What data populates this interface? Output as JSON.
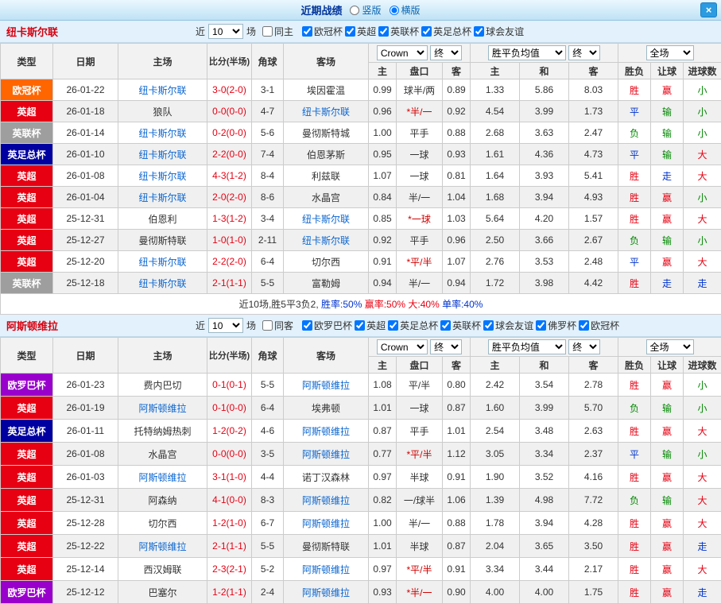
{
  "titlebar": {
    "title": "近期战绩",
    "layout_options": [
      {
        "label": "竖版",
        "selected": false
      },
      {
        "label": "横版",
        "selected": true
      }
    ],
    "close": "×"
  },
  "columns": {
    "type": "类型",
    "date": "日期",
    "home": "主场",
    "score": "比分(半场)",
    "corner": "角球",
    "away": "客场",
    "asian_home": "主",
    "handicap": "盘口",
    "asian_away": "客",
    "euro_home": "主",
    "euro_draw": "和",
    "euro_away": "客",
    "result": "胜负",
    "handicap_result": "让球",
    "goals": "进球数"
  },
  "type_colors": {
    "欧冠杯": "#ff6600",
    "英超": "#e60012",
    "英联杯": "#9e9e9e",
    "英足总杯": "#0000a0",
    "欧罗巴杯": "#9900cc"
  },
  "result_colors": {
    "胜": "#e60012",
    "平": "#0033cc",
    "负": "#008800",
    "赢": "#e60012",
    "输": "#008800",
    "走": "#0033cc",
    "大": "#e60012",
    "小": "#008800"
  },
  "sections": [
    {
      "team": "纽卡斯尔联",
      "near_label": "近",
      "near_count": "10",
      "games_label": "场",
      "same_filter": "同主",
      "leagues": [
        "欧冠杯",
        "英超",
        "英联杯",
        "英足总杯",
        "球会友谊"
      ],
      "selects": {
        "bookmaker": "Crown",
        "bookmaker_time": "终",
        "europe_avg": "胜平负均值",
        "europe_time": "终",
        "scope": "全场"
      },
      "rows": [
        {
          "type": "欧冠杯",
          "date": "26-01-22",
          "home": "纽卡斯尔联",
          "score": "3-0(2-0)",
          "corner": "3-1",
          "away": "埃因霍温",
          "asian_home": "0.99",
          "handicap": "球半/两",
          "asian_away": "0.89",
          "euro_home": "1.33",
          "euro_draw": "5.86",
          "euro_away": "8.03",
          "result": "胜",
          "handicap_result": "赢",
          "goals": "小"
        },
        {
          "type": "英超",
          "date": "26-01-18",
          "home": "狼队",
          "score": "0-0(0-0)",
          "corner": "4-7",
          "away": "纽卡斯尔联",
          "asian_home": "0.96",
          "handicap": "*半/一",
          "asian_away": "0.92",
          "euro_home": "4.54",
          "euro_draw": "3.99",
          "euro_away": "1.73",
          "result": "平",
          "handicap_result": "输",
          "goals": "小"
        },
        {
          "type": "英联杯",
          "date": "26-01-14",
          "home": "纽卡斯尔联",
          "score": "0-2(0-0)",
          "corner": "5-6",
          "away": "曼彻斯特城",
          "asian_home": "1.00",
          "handicap": "平手",
          "asian_away": "0.88",
          "euro_home": "2.68",
          "euro_draw": "3.63",
          "euro_away": "2.47",
          "result": "负",
          "handicap_result": "输",
          "goals": "小"
        },
        {
          "type": "英足总杯",
          "date": "26-01-10",
          "home": "纽卡斯尔联",
          "score": "2-2(0-0)",
          "corner": "7-4",
          "away": "伯恩茅斯",
          "asian_home": "0.95",
          "handicap": "一球",
          "asian_away": "0.93",
          "euro_home": "1.61",
          "euro_draw": "4.36",
          "euro_away": "4.73",
          "result": "平",
          "handicap_result": "输",
          "goals": "大"
        },
        {
          "type": "英超",
          "date": "26-01-08",
          "home": "纽卡斯尔联",
          "score": "4-3(1-2)",
          "corner": "8-4",
          "away": "利兹联",
          "asian_home": "1.07",
          "handicap": "一球",
          "asian_away": "0.81",
          "euro_home": "1.64",
          "euro_draw": "3.93",
          "euro_away": "5.41",
          "result": "胜",
          "handicap_result": "走",
          "goals": "大"
        },
        {
          "type": "英超",
          "date": "26-01-04",
          "home": "纽卡斯尔联",
          "score": "2-0(2-0)",
          "corner": "8-6",
          "away": "水晶宫",
          "asian_home": "0.84",
          "handicap": "半/一",
          "asian_away": "1.04",
          "euro_home": "1.68",
          "euro_draw": "3.94",
          "euro_away": "4.93",
          "result": "胜",
          "handicap_result": "赢",
          "goals": "小"
        },
        {
          "type": "英超",
          "date": "25-12-31",
          "home": "伯恩利",
          "score": "1-3(1-2)",
          "corner": "3-4",
          "away": "纽卡斯尔联",
          "asian_home": "0.85",
          "handicap": "*一球",
          "asian_away": "1.03",
          "euro_home": "5.64",
          "euro_draw": "4.20",
          "euro_away": "1.57",
          "result": "胜",
          "handicap_result": "赢",
          "goals": "大"
        },
        {
          "type": "英超",
          "date": "25-12-27",
          "home": "曼彻斯特联",
          "score": "1-0(1-0)",
          "corner": "2-11",
          "away": "纽卡斯尔联",
          "asian_home": "0.92",
          "handicap": "平手",
          "asian_away": "0.96",
          "euro_home": "2.50",
          "euro_draw": "3.66",
          "euro_away": "2.67",
          "result": "负",
          "handicap_result": "输",
          "goals": "小"
        },
        {
          "type": "英超",
          "date": "25-12-20",
          "home": "纽卡斯尔联",
          "score": "2-2(2-0)",
          "corner": "6-4",
          "away": "切尔西",
          "asian_home": "0.91",
          "handicap": "*平/半",
          "asian_away": "1.07",
          "euro_home": "2.76",
          "euro_draw": "3.53",
          "euro_away": "2.48",
          "result": "平",
          "handicap_result": "赢",
          "goals": "大"
        },
        {
          "type": "英联杯",
          "date": "25-12-18",
          "home": "纽卡斯尔联",
          "score": "2-1(1-1)",
          "corner": "5-5",
          "away": "富勒姆",
          "asian_home": "0.94",
          "handicap": "半/一",
          "asian_away": "0.94",
          "euro_home": "1.72",
          "euro_draw": "3.98",
          "euro_away": "4.42",
          "result": "胜",
          "handicap_result": "走",
          "goals": "走"
        }
      ],
      "summary": [
        {
          "text": "近10场,胜5平3负2,",
          "color": "#333333"
        },
        {
          "text": " 胜率:50%",
          "color": "#0033cc"
        },
        {
          "text": " 赢率:50%",
          "color": "#e60012"
        },
        {
          "text": " 大:40%",
          "color": "#e60012"
        },
        {
          "text": " 单率:40%",
          "color": "#0033cc"
        }
      ]
    },
    {
      "team": "阿斯顿维拉",
      "near_label": "近",
      "near_count": "10",
      "games_label": "场",
      "same_filter": "同客",
      "leagues": [
        "欧罗巴杯",
        "英超",
        "英足总杯",
        "英联杯",
        "球会友谊",
        "佛罗杯",
        "欧冠杯"
      ],
      "selects": {
        "bookmaker": "Crown",
        "bookmaker_time": "终",
        "europe_avg": "胜平负均值",
        "europe_time": "终",
        "scope": "全场"
      },
      "rows": [
        {
          "type": "欧罗巴杯",
          "date": "26-01-23",
          "home": "费内巴切",
          "score": "0-1(0-1)",
          "corner": "5-5",
          "away": "阿斯顿维拉",
          "asian_home": "1.08",
          "handicap": "平/半",
          "asian_away": "0.80",
          "euro_home": "2.42",
          "euro_draw": "3.54",
          "euro_away": "2.78",
          "result": "胜",
          "handicap_result": "赢",
          "goals": "小"
        },
        {
          "type": "英超",
          "date": "26-01-19",
          "home": "阿斯顿维拉",
          "score": "0-1(0-0)",
          "corner": "6-4",
          "away": "埃弗顿",
          "asian_home": "1.01",
          "handicap": "一球",
          "asian_away": "0.87",
          "euro_home": "1.60",
          "euro_draw": "3.99",
          "euro_away": "5.70",
          "result": "负",
          "handicap_result": "输",
          "goals": "小"
        },
        {
          "type": "英足总杯",
          "date": "26-01-11",
          "home": "托特纳姆热刺",
          "score": "1-2(0-2)",
          "corner": "4-6",
          "away": "阿斯顿维拉",
          "asian_home": "0.87",
          "handicap": "平手",
          "asian_away": "1.01",
          "euro_home": "2.54",
          "euro_draw": "3.48",
          "euro_away": "2.63",
          "result": "胜",
          "handicap_result": "赢",
          "goals": "大"
        },
        {
          "type": "英超",
          "date": "26-01-08",
          "home": "水晶宫",
          "score": "0-0(0-0)",
          "corner": "3-5",
          "away": "阿斯顿维拉",
          "asian_home": "0.77",
          "handicap": "*平/半",
          "asian_away": "1.12",
          "euro_home": "3.05",
          "euro_draw": "3.34",
          "euro_away": "2.37",
          "result": "平",
          "handicap_result": "输",
          "goals": "小"
        },
        {
          "type": "英超",
          "date": "26-01-03",
          "home": "阿斯顿维拉",
          "score": "3-1(1-0)",
          "corner": "4-4",
          "away": "诺丁汉森林",
          "asian_home": "0.97",
          "handicap": "半球",
          "asian_away": "0.91",
          "euro_home": "1.90",
          "euro_draw": "3.52",
          "euro_away": "4.16",
          "result": "胜",
          "handicap_result": "赢",
          "goals": "大"
        },
        {
          "type": "英超",
          "date": "25-12-31",
          "home": "阿森纳",
          "score": "4-1(0-0)",
          "corner": "8-3",
          "away": "阿斯顿维拉",
          "asian_home": "0.82",
          "handicap": "一/球半",
          "asian_away": "1.06",
          "euro_home": "1.39",
          "euro_draw": "4.98",
          "euro_away": "7.72",
          "result": "负",
          "handicap_result": "输",
          "goals": "大"
        },
        {
          "type": "英超",
          "date": "25-12-28",
          "home": "切尔西",
          "score": "1-2(1-0)",
          "corner": "6-7",
          "away": "阿斯顿维拉",
          "asian_home": "1.00",
          "handicap": "半/一",
          "asian_away": "0.88",
          "euro_home": "1.78",
          "euro_draw": "3.94",
          "euro_away": "4.28",
          "result": "胜",
          "handicap_result": "赢",
          "goals": "大"
        },
        {
          "type": "英超",
          "date": "25-12-22",
          "home": "阿斯顿维拉",
          "score": "2-1(1-1)",
          "corner": "5-5",
          "away": "曼彻斯特联",
          "asian_home": "1.01",
          "handicap": "半球",
          "asian_away": "0.87",
          "euro_home": "2.04",
          "euro_draw": "3.65",
          "euro_away": "3.50",
          "result": "胜",
          "handicap_result": "赢",
          "goals": "走"
        },
        {
          "type": "英超",
          "date": "25-12-14",
          "home": "西汉姆联",
          "score": "2-3(2-1)",
          "corner": "5-2",
          "away": "阿斯顿维拉",
          "asian_home": "0.97",
          "handicap": "*平/半",
          "asian_away": "0.91",
          "euro_home": "3.34",
          "euro_draw": "3.44",
          "euro_away": "2.17",
          "result": "胜",
          "handicap_result": "赢",
          "goals": "大"
        },
        {
          "type": "欧罗巴杯",
          "date": "25-12-12",
          "home": "巴塞尔",
          "score": "1-2(1-1)",
          "corner": "2-4",
          "away": "阿斯顿维拉",
          "asian_home": "0.93",
          "handicap": "*半/一",
          "asian_away": "0.90",
          "euro_home": "4.00",
          "euro_draw": "4.00",
          "euro_away": "1.75",
          "result": "胜",
          "handicap_result": "赢",
          "goals": "走"
        }
      ],
      "summary": []
    }
  ]
}
